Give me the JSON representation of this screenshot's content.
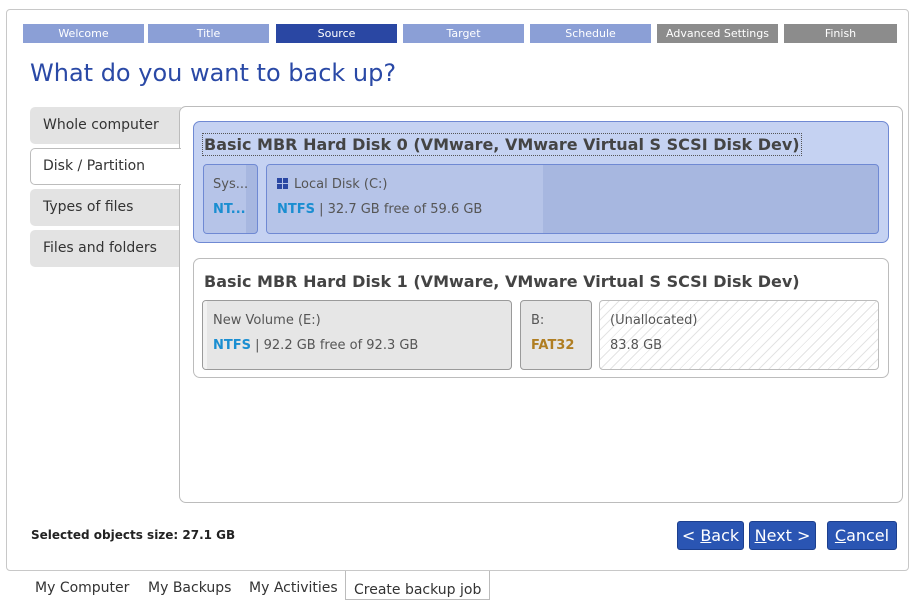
{
  "wizard": {
    "steps": [
      {
        "label": "Welcome",
        "state": "done"
      },
      {
        "label": "Title",
        "state": "done"
      },
      {
        "label": "Source",
        "state": "active"
      },
      {
        "label": "Target",
        "state": "done"
      },
      {
        "label": "Schedule",
        "state": "done"
      },
      {
        "label": "Advanced Settings",
        "state": "todo"
      },
      {
        "label": "Finish",
        "state": "todo"
      }
    ]
  },
  "page_title": "What do you want to back up?",
  "source_tabs": [
    {
      "label": "Whole computer",
      "selected": false
    },
    {
      "label": "Disk / Partition",
      "selected": true
    },
    {
      "label": "Types of files",
      "selected": false
    },
    {
      "label": "Files and folders",
      "selected": false
    }
  ],
  "disks": [
    {
      "title": "Basic MBR Hard Disk 0 (VMware, VMware Virtual S SCSI Disk Dev)",
      "selected": true,
      "partitions": [
        {
          "label": "Sys...",
          "fs": "NT...",
          "detail": ""
        },
        {
          "label": "Local Disk (C:)",
          "fs": "NTFS",
          "detail": " | 32.7 GB free of 59.6 GB",
          "icon": "windows-icon",
          "used_fraction": 0.45
        }
      ]
    },
    {
      "title": "Basic MBR Hard Disk 1 (VMware, VMware Virtual S SCSI Disk Dev)",
      "selected": false,
      "partitions": [
        {
          "label": "New Volume (E:)",
          "fs": "NTFS",
          "detail": " | 92.2 GB free of 92.3 GB",
          "used_fraction": 0.0
        },
        {
          "label": "B:",
          "fs": "FAT32",
          "detail": ""
        },
        {
          "label": "(Unallocated)",
          "fs": "",
          "detail": "83.8 GB"
        }
      ]
    }
  ],
  "footer": {
    "selected_size": "Selected objects size: 27.1 GB",
    "back": {
      "prefix": "< ",
      "key": "B",
      "rest": "ack"
    },
    "next": {
      "key": "N",
      "rest": "ext >"
    },
    "cancel": {
      "key": "C",
      "rest": "ancel"
    }
  },
  "bottom_tabs": [
    "My Computer",
    "My Backups",
    "My Activities",
    "Create backup job"
  ],
  "colors": {
    "accent": "#2a47a3",
    "title": "#2a49a6",
    "ntfs": "#1a8ed1",
    "fat32": "#b07e22"
  }
}
